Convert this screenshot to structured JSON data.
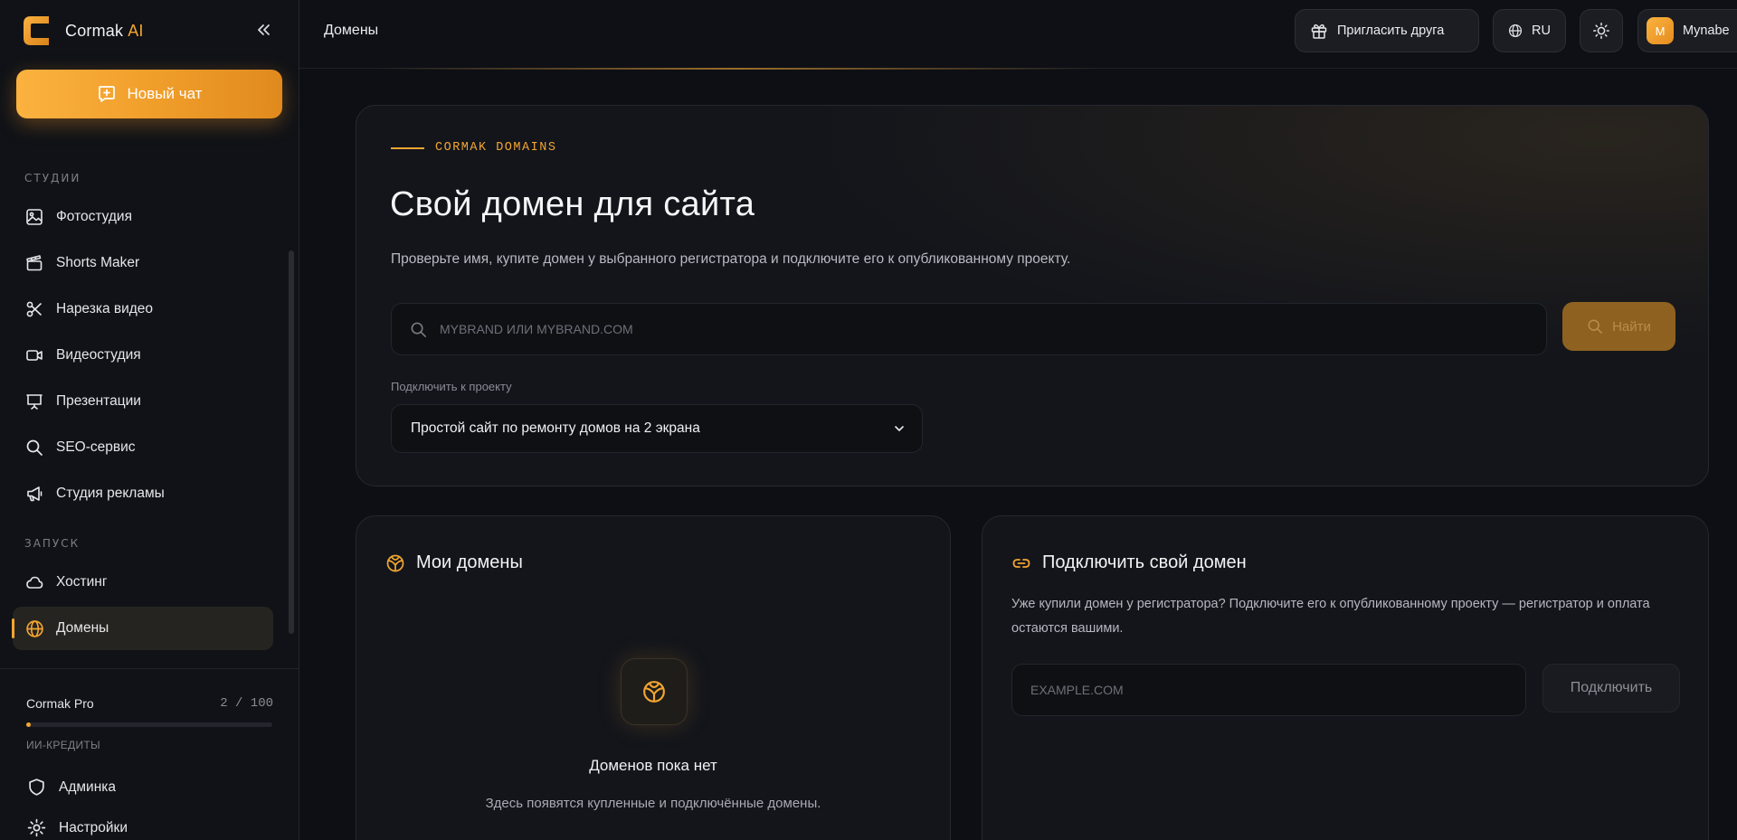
{
  "app": {
    "name": "Cormak",
    "name_suffix": "AI"
  },
  "sidebar": {
    "new_chat_label": "Новый чат",
    "sections": [
      {
        "title": "Студии"
      },
      {
        "title": "Запуск"
      }
    ],
    "items": [
      {
        "label": "Фотостудия",
        "icon": "image-icon"
      },
      {
        "label": "Shorts Maker",
        "icon": "clapperboard-icon"
      },
      {
        "label": "Нарезка видео",
        "icon": "scissors-icon"
      },
      {
        "label": "Видеостудия",
        "icon": "video-camera-icon"
      },
      {
        "label": "Презентации",
        "icon": "presentation-icon"
      },
      {
        "label": "SEO-сервис",
        "icon": "search-icon"
      },
      {
        "label": "Студия рекламы",
        "icon": "megaphone-icon"
      },
      {
        "label": "Хостинг",
        "icon": "cloud-icon"
      },
      {
        "label": "Домены",
        "icon": "globe-icon",
        "active": true
      }
    ],
    "plan": {
      "name": "Cormak Pro",
      "count": "2 / 100",
      "used_fraction": 0.02,
      "credits_label": "ИИ-кредиты"
    },
    "footer_items": [
      {
        "label": "Админка",
        "icon": "shield-icon"
      },
      {
        "label": "Настройки",
        "icon": "gear-icon"
      }
    ]
  },
  "topbar": {
    "page_title": "Домены",
    "invite_label": "Пригласить друга",
    "language": "RU",
    "user_initial": "M",
    "user_name": "Mynabe"
  },
  "hero": {
    "eyebrow": "CORMAK DOMAINS",
    "title": "Свой домен для сайта",
    "subtitle": "Проверьте имя, купите домен у выбранного регистратора и подключите его к опубликованному проекту.",
    "search_placeholder": "mybrand или mybrand.com",
    "find_label": "Найти",
    "project_label": "Подключить к проекту",
    "project_selected": "Простой сайт по ремонту домов на 2 экрана"
  },
  "my_domains": {
    "title": "Мои домены",
    "empty_title": "Доменов пока нет",
    "empty_text": "Здесь появятся купленные и подключённые домены."
  },
  "connect": {
    "title": "Подключить свой домен",
    "description": "Уже купили домен у регистратора? Подключите его к опубликованному проекту — регистратор и оплата остаются вашими.",
    "input_placeholder": "example.com",
    "button_label": "Подключить"
  },
  "colors": {
    "accent": "#f2a531",
    "background": "#0d0f14",
    "card": "#13151b"
  }
}
